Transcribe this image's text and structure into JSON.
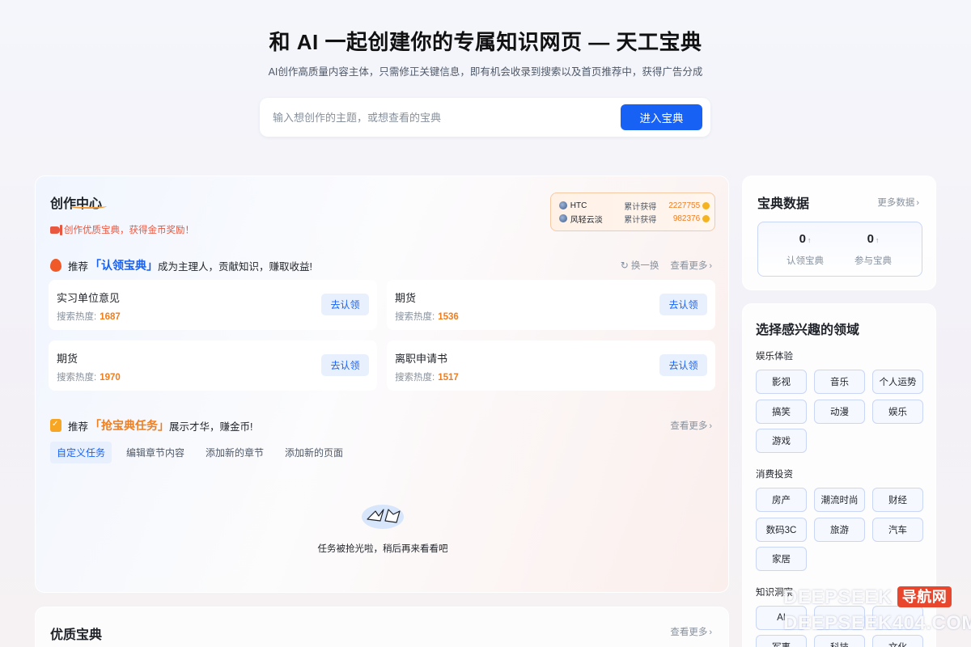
{
  "hero": {
    "title": "和 AI 一起创建你的专属知识网页 — 天工宝典",
    "subtitle": "AI创作高质量内容主体，只需修正关键信息，即有机会收录到搜索以及首页推荐中，获得广告分成",
    "search_placeholder": "输入想创作的主题，或想查看的宝典",
    "search_button": "进入宝典"
  },
  "create": {
    "title": "创作中心",
    "reward_text": "创作优质宝典，获得金币奖励！",
    "leaderboard": [
      {
        "name": "HTC",
        "label": "累计获得",
        "value": "2227755"
      },
      {
        "name": "风轻云淡",
        "label": "累计获得",
        "value": "982376"
      }
    ],
    "claim_section": {
      "pre": "推荐",
      "highlight": "「认领宝典」",
      "post": "成为主理人，贡献知识，赚取收益!",
      "refresh": "换一换",
      "more": "查看更多"
    },
    "claim_items": [
      {
        "title": "实习单位意见",
        "heat_label": "搜索热度:",
        "heat": "1687",
        "button": "去认领"
      },
      {
        "title": "期货",
        "heat_label": "搜索热度:",
        "heat": "1536",
        "button": "去认领"
      },
      {
        "title": "期货",
        "heat_label": "搜索热度:",
        "heat": "1970",
        "button": "去认领"
      },
      {
        "title": "离职申请书",
        "heat_label": "搜索热度:",
        "heat": "1517",
        "button": "去认领"
      }
    ],
    "task_section": {
      "pre": "推荐",
      "highlight": "「抢宝典任务」",
      "post": "展示才华，赚金币!",
      "more": "查看更多"
    },
    "task_tabs": [
      "自定义任务",
      "编辑章节内容",
      "添加新的章节",
      "添加新的页面"
    ],
    "empty_text": "任务被抢光啦，稍后再来看看吧"
  },
  "quality": {
    "title": "优质宝典",
    "more": "查看更多"
  },
  "stats": {
    "title": "宝典数据",
    "more": "更多数据",
    "items": [
      {
        "value": "0",
        "label": "认领宝典"
      },
      {
        "value": "0",
        "label": "参与宝典"
      }
    ]
  },
  "fields": {
    "title": "选择感兴趣的领域",
    "groups": [
      {
        "name": "娱乐体验",
        "chips": [
          "影视",
          "音乐",
          "个人运势",
          "搞笑",
          "动漫",
          "娱乐",
          "游戏"
        ]
      },
      {
        "name": "消费投资",
        "chips": [
          "房产",
          "潮流时尚",
          "财经",
          "数码3C",
          "旅游",
          "汽车",
          "家居"
        ]
      },
      {
        "name": "知识洞察",
        "chips": [
          "AI",
          "",
          "",
          "军事",
          "科技",
          "文化"
        ]
      }
    ]
  },
  "watermark": {
    "line1": "DEEPSEEK",
    "tag": "导航网",
    "line2": "DEEPSEEK404.COM"
  }
}
